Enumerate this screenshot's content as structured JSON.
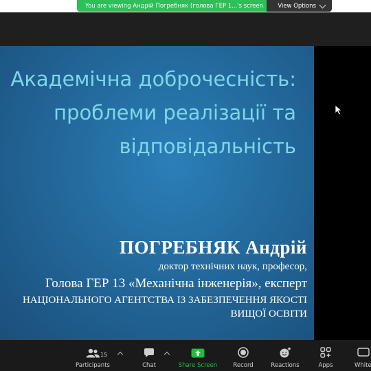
{
  "banner": {
    "text": "You are viewing Андрій Погребняк (голова ГЕР 1...'s screen",
    "button": "View Options"
  },
  "slide": {
    "title_lines": [
      "Академічна доброчесність:",
      "проблеми реалізації та",
      "відповідальність"
    ],
    "author_name": "ПОГРЕБНЯК Андрій",
    "author_degree": "доктор технічних наук, професор,",
    "author_role": "Голова ГЕР 13 «Механічна інженерія», експерт",
    "agency_line1": "НАЦІОНАЛЬНОГО АГЕНТСТВА ІЗ ЗАБЕЗПЕЧЕННЯ ЯКОСТІ",
    "agency_line2": "ВИЩОЇ ОСВІТИ"
  },
  "toolbar": {
    "participants_count": "15",
    "items": [
      {
        "label": "Participants",
        "icon": "participants-icon"
      },
      {
        "label": "Chat",
        "icon": "chat-icon"
      },
      {
        "label": "Share Screen",
        "icon": "share-screen-icon"
      },
      {
        "label": "Record",
        "icon": "record-icon"
      },
      {
        "label": "Reactions",
        "icon": "reactions-icon"
      },
      {
        "label": "Apps",
        "icon": "apps-icon"
      },
      {
        "label": "Whiteboards",
        "icon": "whiteboards-icon"
      }
    ]
  },
  "colors": {
    "banner": "#2fbf58",
    "share": "#1fbf3a",
    "title": "#7fd6e8",
    "slide_bg": "#23699c"
  }
}
